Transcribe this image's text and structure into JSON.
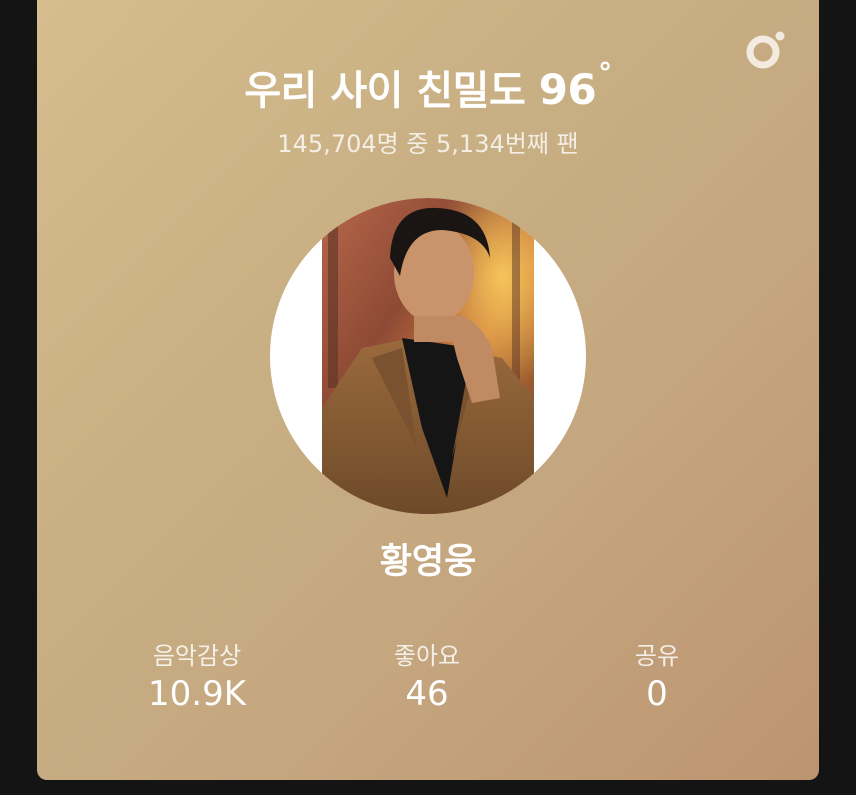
{
  "header": {
    "title_prefix": "우리 사이 친밀도",
    "intimacy_score": "96",
    "degree_symbol": "°",
    "subtitle": "145,704명 중 5,134번째 팬"
  },
  "profile": {
    "artist_name": "황영웅"
  },
  "stats": [
    {
      "label": "음악감상",
      "value": "10.9K"
    },
    {
      "label": "좋아요",
      "value": "46"
    },
    {
      "label": "공유",
      "value": "0"
    }
  ],
  "colors": {
    "card_gradient_start": "#d6bd8e",
    "card_gradient_end": "#bc9470",
    "text": "#ffffff",
    "background": "#141414"
  },
  "icons": {
    "logo": "app-logo-icon"
  }
}
